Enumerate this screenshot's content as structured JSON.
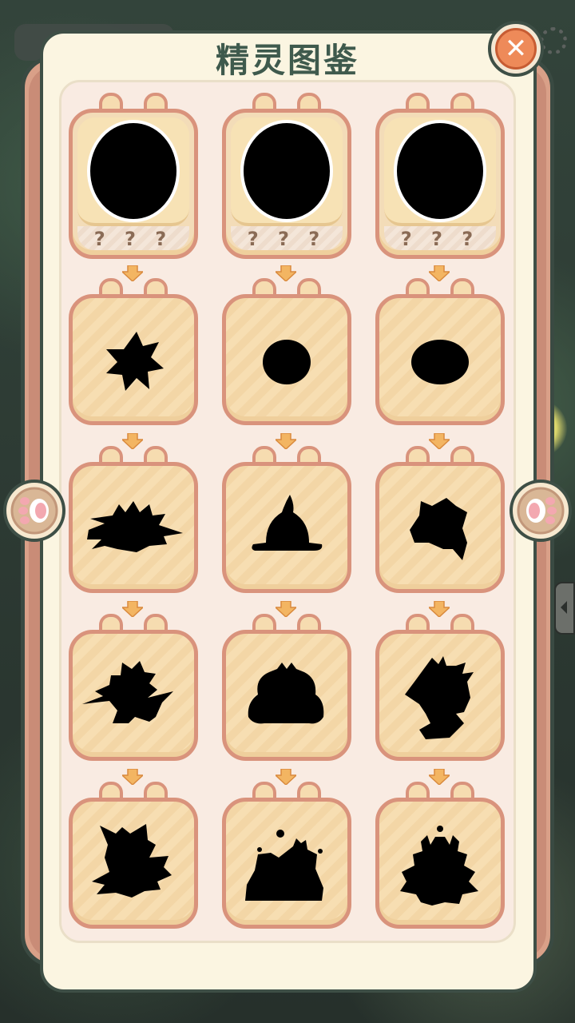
{
  "title": "精灵图鉴",
  "close_label": "✕",
  "locked_label": "? ? ?",
  "colors": {
    "accent": "#ee8a59",
    "panel": "#fbf5e1",
    "card_border": "#d9937c",
    "title": "#3f5a4d"
  },
  "icons": {
    "close": "close-icon",
    "prev": "paw-icon",
    "next": "paw-icon",
    "evolution_arrow": "arrow-down-icon"
  },
  "rows": [
    {
      "type": "unknown",
      "cards": [
        "unknown-spirit",
        "unknown-spirit",
        "unknown-spirit"
      ]
    },
    {
      "type": "silhouette",
      "cards": [
        "spiky-star-spirit",
        "round-blob-spirit",
        "oval-blob-spirit"
      ]
    },
    {
      "type": "silhouette",
      "cards": [
        "spiky-hedgehog-spirit",
        "onion-sprout-spirit",
        "horned-beast-head-spirit"
      ]
    },
    {
      "type": "silhouette",
      "cards": [
        "lightning-imp-spirit",
        "crowned-frog-spirit",
        "antlered-fox-spirit"
      ]
    },
    {
      "type": "silhouette",
      "cards": [
        "winged-cat-spirit",
        "volcano-golem-spirit",
        "crab-king-spirit"
      ]
    }
  ]
}
